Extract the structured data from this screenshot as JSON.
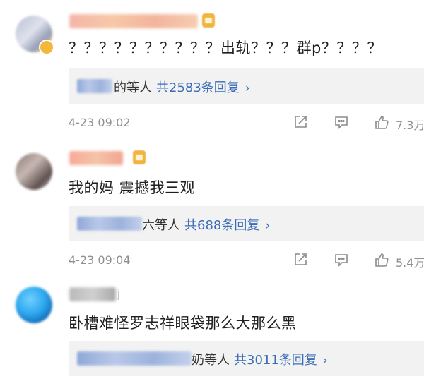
{
  "comments": [
    {
      "text": "？？？？？？？？？？出轨？？？群p？？？？",
      "reply_suffix": "的等人",
      "reply_count": "共2583条回复",
      "reply_arrow": "›",
      "timestamp": "4-23 09:02",
      "likes": "7.3万"
    },
    {
      "text": "我的妈 震撼我三观",
      "reply_suffix": "六等人",
      "reply_count": "共688条回复",
      "reply_arrow": "›",
      "timestamp": "4-23 09:04",
      "likes": "5.4万"
    },
    {
      "text": "卧槽难怪罗志祥眼袋那么大那么黑",
      "username_tail": "j",
      "reply_suffix": "奶等人",
      "reply_count": "共3011条回复",
      "reply_arrow": "›"
    }
  ],
  "icons": {
    "share": "share-icon",
    "comment": "comment-icon",
    "like": "thumbs-up-icon"
  },
  "colors": {
    "link_blue": "#3b6cb7",
    "meta_gray": "#8f8f8f",
    "reply_bg": "#f2f2f2"
  }
}
